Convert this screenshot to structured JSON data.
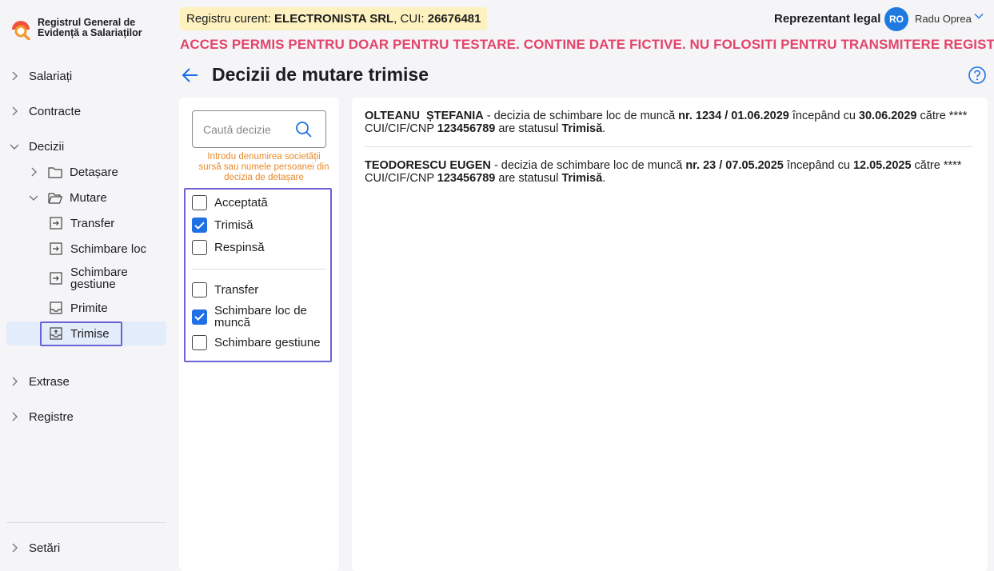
{
  "app": {
    "title_line1": "Registrul General de",
    "title_line2": "Evidență a Salariaților"
  },
  "sidebar": {
    "salariati": "Salariați",
    "contracte": "Contracte",
    "decizii": "Decizii",
    "detasare": "Detașare",
    "mutare": "Mutare",
    "transfer": "Transfer",
    "schimbare_loc": "Schimbare loc",
    "schimbare_gestiune_1": "Schimbare",
    "schimbare_gestiune_2": "gestiune",
    "primite": "Primite",
    "trimise": "Trimise",
    "extrase": "Extrase",
    "registre": "Registre",
    "setari": "Setări"
  },
  "header": {
    "registry_prefix": "Registru curent: ",
    "company": "ELECTRONISTA SRL",
    "cui_prefix": ", CUI: ",
    "cui": "26676481",
    "rep_label": "Reprezentant legal",
    "avatar_initials": "RO",
    "user_name": "Radu Oprea",
    "warning": "ACCES PERMIS PENTRU DOAR PENTRU TESTARE. CONTINE DATE FICTIVE. NU FOLOSITI PENTRU TRANSMITERE REGISTRU"
  },
  "page": {
    "title": "Decizii de mutare trimise"
  },
  "filters": {
    "search_placeholder": "Caută decizie",
    "hint": "Introdu denumirea societății sursă sau numele persoanei din decizia de detașare",
    "status": [
      {
        "label": "Acceptată",
        "checked": false
      },
      {
        "label": "Trimisă",
        "checked": true
      },
      {
        "label": "Respinsă",
        "checked": false
      }
    ],
    "type": [
      {
        "label": "Transfer",
        "checked": false
      },
      {
        "label": "Schimbare loc de muncă",
        "checked": true
      },
      {
        "label": "Schimbare gestiune",
        "checked": false
      }
    ]
  },
  "results": [
    {
      "name": "OLTEANU  ȘTEFANIA",
      "text1": " - decizia de schimbare loc de muncă ",
      "number": "nr. 1234 / 01.06.2029",
      "text2": " începând cu ",
      "start": "30.06.2029",
      "text3": " către **** CUI/CIF/CNP ",
      "cui": "123456789",
      "text4": " are statusul ",
      "status": "Trimisă",
      "end": "."
    },
    {
      "name": "TEODORESCU EUGEN",
      "text1": " - decizia de schimbare loc de muncă ",
      "number": "nr. 23 / 07.05.2025",
      "text2": " începând cu ",
      "start": "12.05.2025",
      "text3": " către **** CUI/CIF/CNP ",
      "cui": "123456789",
      "text4": " are statusul ",
      "status": "Trimisă",
      "end": "."
    }
  ],
  "colors": {
    "accent": "#1f6fe5",
    "warning": "#e2456a",
    "hint": "#e98a2a",
    "badge_bg": "#fdf2bf",
    "highlight_frame": "#6b62d6"
  }
}
